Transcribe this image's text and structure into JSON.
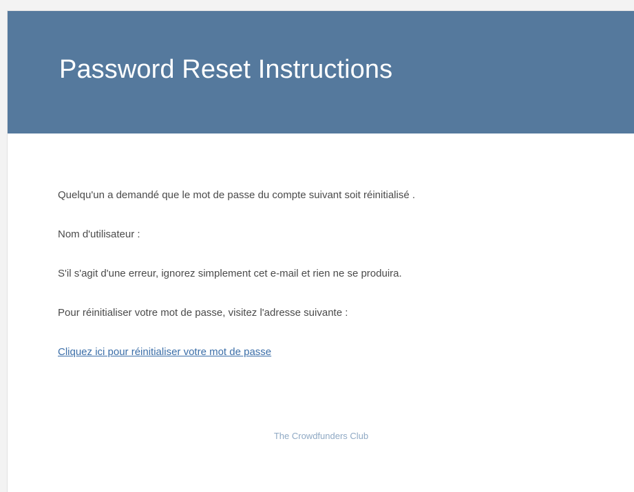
{
  "header": {
    "title": "Password Reset Instructions",
    "background_color": "#55799d"
  },
  "body": {
    "intro": "Quelqu'un a demandé que le mot de passe du compte suivant soit réinitialisé .",
    "username_label": "Nom d'utilisateur :",
    "error_notice": "S'il s'agit d'une erreur, ignorez simplement cet e-mail et rien ne se produira.",
    "visit_instruction": "Pour réinitialiser votre mot de passe, visitez l'adresse suivante :",
    "reset_link_text": "Cliquez ici pour réinitialiser votre mot de passe",
    "link_color": "#3b6ea8"
  },
  "footer": {
    "brand": "The Crowdfunders Club"
  }
}
